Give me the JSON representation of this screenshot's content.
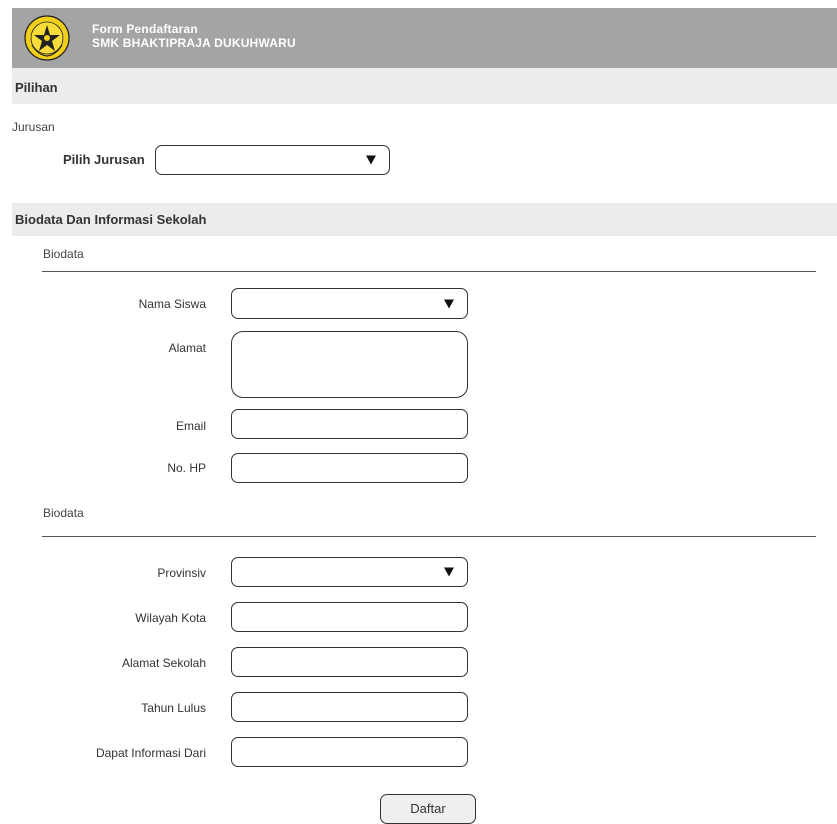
{
  "header": {
    "line1": "Form Pendaftaran",
    "line2": "SMK BHAKTIPRAJA DUKUHWARU",
    "logo_icon": "school-emblem-icon",
    "bg_color": "#a4a4a4"
  },
  "pilihan": {
    "title": "Pilihan",
    "group_label": "Jurusan",
    "field_label": "Pilih Jurusan",
    "field_value": ""
  },
  "biodata_section": {
    "title": "Biodata Dan  Informasi Sekolah",
    "biodata_label": "Biodata",
    "fields": {
      "nama_siswa": "Nama Siswa",
      "alamat": "Alamat",
      "email": "Email",
      "no_hp": "No. HP"
    }
  },
  "sekolah_section": {
    "label": "Biodata",
    "fields": {
      "provinsi": "Provinsiv",
      "wilayah_kota": "Wilayah Kota",
      "alamat_sekolah": "Alamat Sekolah",
      "tahun_lulus": "Tahun Lulus",
      "informasi_dari": "Dapat Informasi Dari"
    }
  },
  "submit_label": "Daftar"
}
